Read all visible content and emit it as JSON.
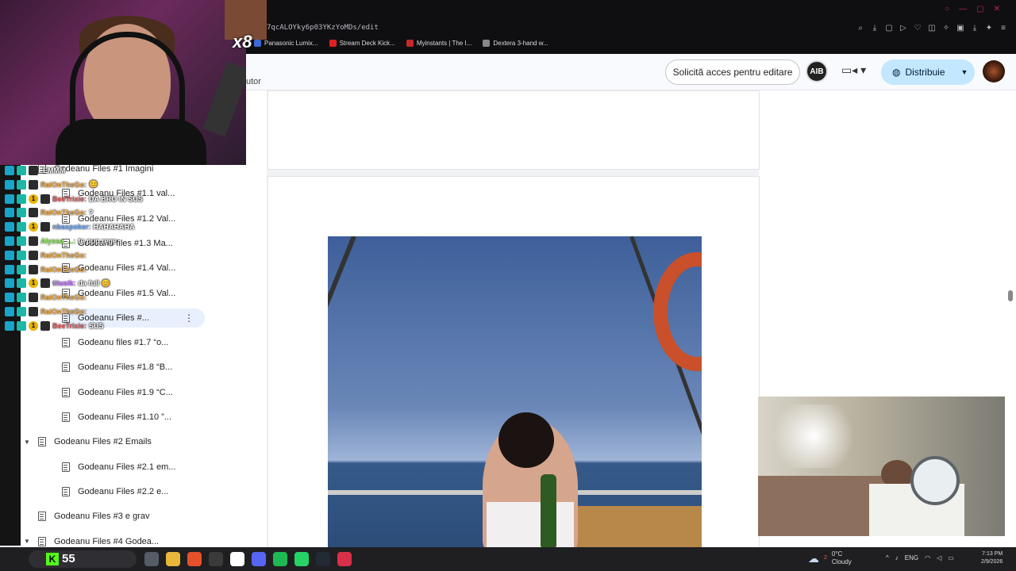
{
  "browser": {
    "url_fragment": "7qcALOYky6p03YKzYoMDs/edit",
    "bookmarks": [
      {
        "label": "Panasonic Lumix...",
        "color": "#3b6ad6"
      },
      {
        "label": "Stream Deck Kick...",
        "color": "#e02020"
      },
      {
        "label": "Myinstants | The I...",
        "color": "#c42a2a"
      },
      {
        "label": "Dextera 3-hand w...",
        "color": "#888888"
      }
    ],
    "overlay_text": "x8"
  },
  "docs": {
    "menu_fragment": "utor",
    "request_access_label": "Solicită acces pentru editare",
    "avatar_label": "AIB",
    "share_label": "Distribuie"
  },
  "outline": {
    "items": [
      {
        "label": "Godeanu Files #1 Imagini",
        "level": 1,
        "active": false
      },
      {
        "label": "Godeanu Files #1.1 val...",
        "level": 2,
        "active": false
      },
      {
        "label": "Godeanu Files #1.2 Val...",
        "level": 2,
        "active": false
      },
      {
        "label": "Godeanu files #1.3 Ma...",
        "level": 2,
        "active": false
      },
      {
        "label": "Godeanu Files #1.4 Val...",
        "level": 2,
        "active": false
      },
      {
        "label": "Godeanu Files #1.5 Val...",
        "level": 2,
        "active": false
      },
      {
        "label": "Godeanu Files #...",
        "level": 2,
        "active": true
      },
      {
        "label": "Godeanu files #1.7 “o...",
        "level": 2,
        "active": false
      },
      {
        "label": "Godeanu Files #1.8 “B...",
        "level": 2,
        "active": false
      },
      {
        "label": "Godeanu Files #1.9 “C...",
        "level": 2,
        "active": false
      },
      {
        "label": "Godeanu Files #1.10 ”...",
        "level": 2,
        "active": false
      },
      {
        "label": "Godeanu Files #2 Emails",
        "level": 1,
        "active": false,
        "expanded": true
      },
      {
        "label": "Godeanu Files #2.1 em...",
        "level": 2,
        "active": false
      },
      {
        "label": "Godeanu Files #2.2 e...",
        "level": 2,
        "active": false
      },
      {
        "label": "Godeanu Files #3 e grav",
        "level": 1,
        "active": false
      },
      {
        "label": "Godeanu Files #4 Godea...",
        "level": 1,
        "active": false,
        "expanded": true
      }
    ]
  },
  "chat": {
    "messages": [
      {
        "user": "",
        "text": "EMMM",
        "color": "#ffffff",
        "badge": false
      },
      {
        "user": "RaiOnTheGo:",
        "text": "😊",
        "color": "#e8a33c",
        "badge": false
      },
      {
        "user": "BeeTrixie:",
        "text": "DA BRO IN SUS",
        "color": "#e05a5a",
        "badge": true
      },
      {
        "user": "RaiOnTheGo:",
        "text": "?",
        "color": "#e8a33c",
        "badge": false
      },
      {
        "user": "nbaspoker:",
        "text": "HAHAHAHA",
        "color": "#6aa4f0",
        "badge": true
      },
      {
        "user": "Alyssa_...:",
        "text": "te pup rege",
        "color": "#8be35a",
        "badge": false
      },
      {
        "user": "RaiOnTheGo:",
        "text": "",
        "color": "#e8a33c",
        "badge": false
      },
      {
        "user": "RaiOnTheGo:",
        "text": "",
        "color": "#e8a33c",
        "badge": false
      },
      {
        "user": "titusik:",
        "text": "da full 😊",
        "color": "#b76af0",
        "badge": true
      },
      {
        "user": "RaiOnTheGo:",
        "text": "",
        "color": "#e8a33c",
        "badge": false
      },
      {
        "user": "RaiOnTheGo:",
        "text": "",
        "color": "#e8a33c",
        "badge": false
      },
      {
        "user": "BeeTrixie:",
        "text": "SUS",
        "color": "#e05a5a",
        "badge": true
      }
    ]
  },
  "taskbar": {
    "kick_count": "55",
    "weather_temp": "0°C",
    "weather_desc": "Cloudy",
    "weather_badge": "2",
    "language": "ENG",
    "time": "7:13 PM",
    "date": "2/9/2026",
    "apps": [
      {
        "name": "task-view",
        "color": "#555c66"
      },
      {
        "name": "file-explorer",
        "color": "#e8b73a"
      },
      {
        "name": "brave",
        "color": "#e6502a"
      },
      {
        "name": "obs",
        "color": "#3a3a3a"
      },
      {
        "name": "store",
        "color": "#ffffff"
      },
      {
        "name": "discord",
        "color": "#5865f2"
      },
      {
        "name": "spotify",
        "color": "#1db954"
      },
      {
        "name": "whatsapp",
        "color": "#25d366"
      },
      {
        "name": "steam",
        "color": "#222a36"
      },
      {
        "name": "recorder",
        "color": "#d9304a"
      }
    ]
  }
}
